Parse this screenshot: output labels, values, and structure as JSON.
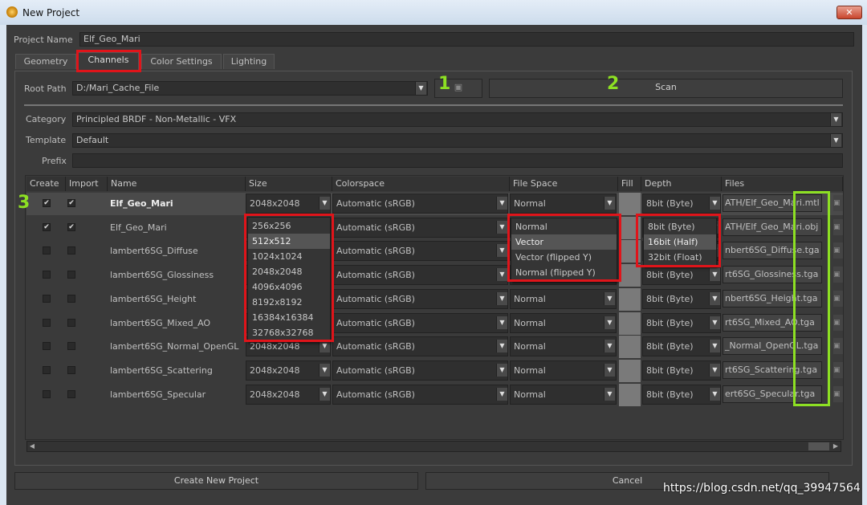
{
  "window": {
    "title": "New Project",
    "close_label": "✕"
  },
  "project_name": {
    "label": "Project Name",
    "value": "Elf_Geo_Mari"
  },
  "tabs": [
    {
      "label": "Geometry"
    },
    {
      "label": "Channels",
      "active": true
    },
    {
      "label": "Color Settings"
    },
    {
      "label": "Lighting"
    }
  ],
  "root_path": {
    "label": "Root Path",
    "value": "D:/Mari_Cache_File"
  },
  "scan_label": "Scan",
  "category": {
    "label": "Category",
    "value": "Principled BRDF - Non-Metallic - VFX"
  },
  "template": {
    "label": "Template",
    "value": "Default"
  },
  "prefix": {
    "label": "Prefix",
    "value": ""
  },
  "table": {
    "columns": [
      "Create",
      "Import",
      "Name",
      "Size",
      "Colorspace",
      "File Space",
      "Fill",
      "Depth",
      "Files"
    ],
    "rows": [
      {
        "create": true,
        "import": true,
        "name": "Elf_Geo_Mari",
        "size": "2048x2048",
        "colorspace": "Automatic (sRGB)",
        "filespace": "Normal",
        "depth": "8bit (Byte)",
        "file": "ATH/Elf_Geo_Mari.mtl",
        "selected": true
      },
      {
        "create": true,
        "import": true,
        "name": "Elf_Geo_Mari",
        "size": "2048x2048",
        "colorspace": "Automatic (sRGB)",
        "filespace": "Normal",
        "depth": "8bit (Byte)",
        "file": "ATH/Elf_Geo_Mari.obj"
      },
      {
        "create": false,
        "import": false,
        "name": "lambert6SG_Diffuse",
        "size": "2048x2048",
        "colorspace": "Automatic (sRGB)",
        "filespace": "Normal",
        "depth": "8bit (Byte)",
        "file": "nbert6SG_Diffuse.tga"
      },
      {
        "create": false,
        "import": false,
        "name": "lambert6SG_Glossiness",
        "size": "2048x2048",
        "colorspace": "Automatic (sRGB)",
        "filespace": "Normal",
        "depth": "8bit (Byte)",
        "file": "rt6SG_Glossiness.tga"
      },
      {
        "create": false,
        "import": false,
        "name": "lambert6SG_Height",
        "size": "2048x2048",
        "colorspace": "Automatic (sRGB)",
        "filespace": "Normal",
        "depth": "8bit (Byte)",
        "file": "nbert6SG_Height.tga"
      },
      {
        "create": false,
        "import": false,
        "name": "lambert6SG_Mixed_AO",
        "size": "2048x2048",
        "colorspace": "Automatic (sRGB)",
        "filespace": "Normal",
        "depth": "8bit (Byte)",
        "file": "rt6SG_Mixed_AO.tga"
      },
      {
        "create": false,
        "import": false,
        "name": "lambert6SG_Normal_OpenGL",
        "size": "2048x2048",
        "colorspace": "Automatic (sRGB)",
        "filespace": "Normal",
        "depth": "8bit (Byte)",
        "file": "_Normal_OpenGL.tga"
      },
      {
        "create": false,
        "import": false,
        "name": "lambert6SG_Scattering",
        "size": "2048x2048",
        "colorspace": "Automatic (sRGB)",
        "filespace": "Normal",
        "depth": "8bit (Byte)",
        "file": "rt6SG_Scattering.tga"
      },
      {
        "create": false,
        "import": false,
        "name": "lambert6SG_Specular",
        "size": "2048x2048",
        "colorspace": "Automatic (sRGB)",
        "filespace": "Normal",
        "depth": "8bit (Byte)",
        "file": "ert6SG_Specular.tga"
      }
    ]
  },
  "size_dropdown": {
    "options": [
      "256x256",
      "512x512",
      "1024x1024",
      "2048x2048",
      "4096x4096",
      "8192x8192",
      "16384x16384",
      "32768x32768"
    ],
    "highlighted": "512x512"
  },
  "filespace_dropdown": {
    "options": [
      "Normal",
      "Vector",
      "Vector (flipped Y)",
      "Normal (flipped Y)"
    ],
    "highlighted": "Vector"
  },
  "depth_dropdown": {
    "options": [
      "8bit (Byte)",
      "16bit (Half)",
      "32bit (Float)"
    ],
    "highlighted": "16bit (Half)"
  },
  "buttons": {
    "create": "Create New Project",
    "cancel": "Cancel"
  },
  "annotations": {
    "n1": "1",
    "n2": "2",
    "n3": "3",
    "red": "#e0141a",
    "green": "#8de023"
  },
  "watermark": "https://blog.csdn.net/qq_39947564"
}
